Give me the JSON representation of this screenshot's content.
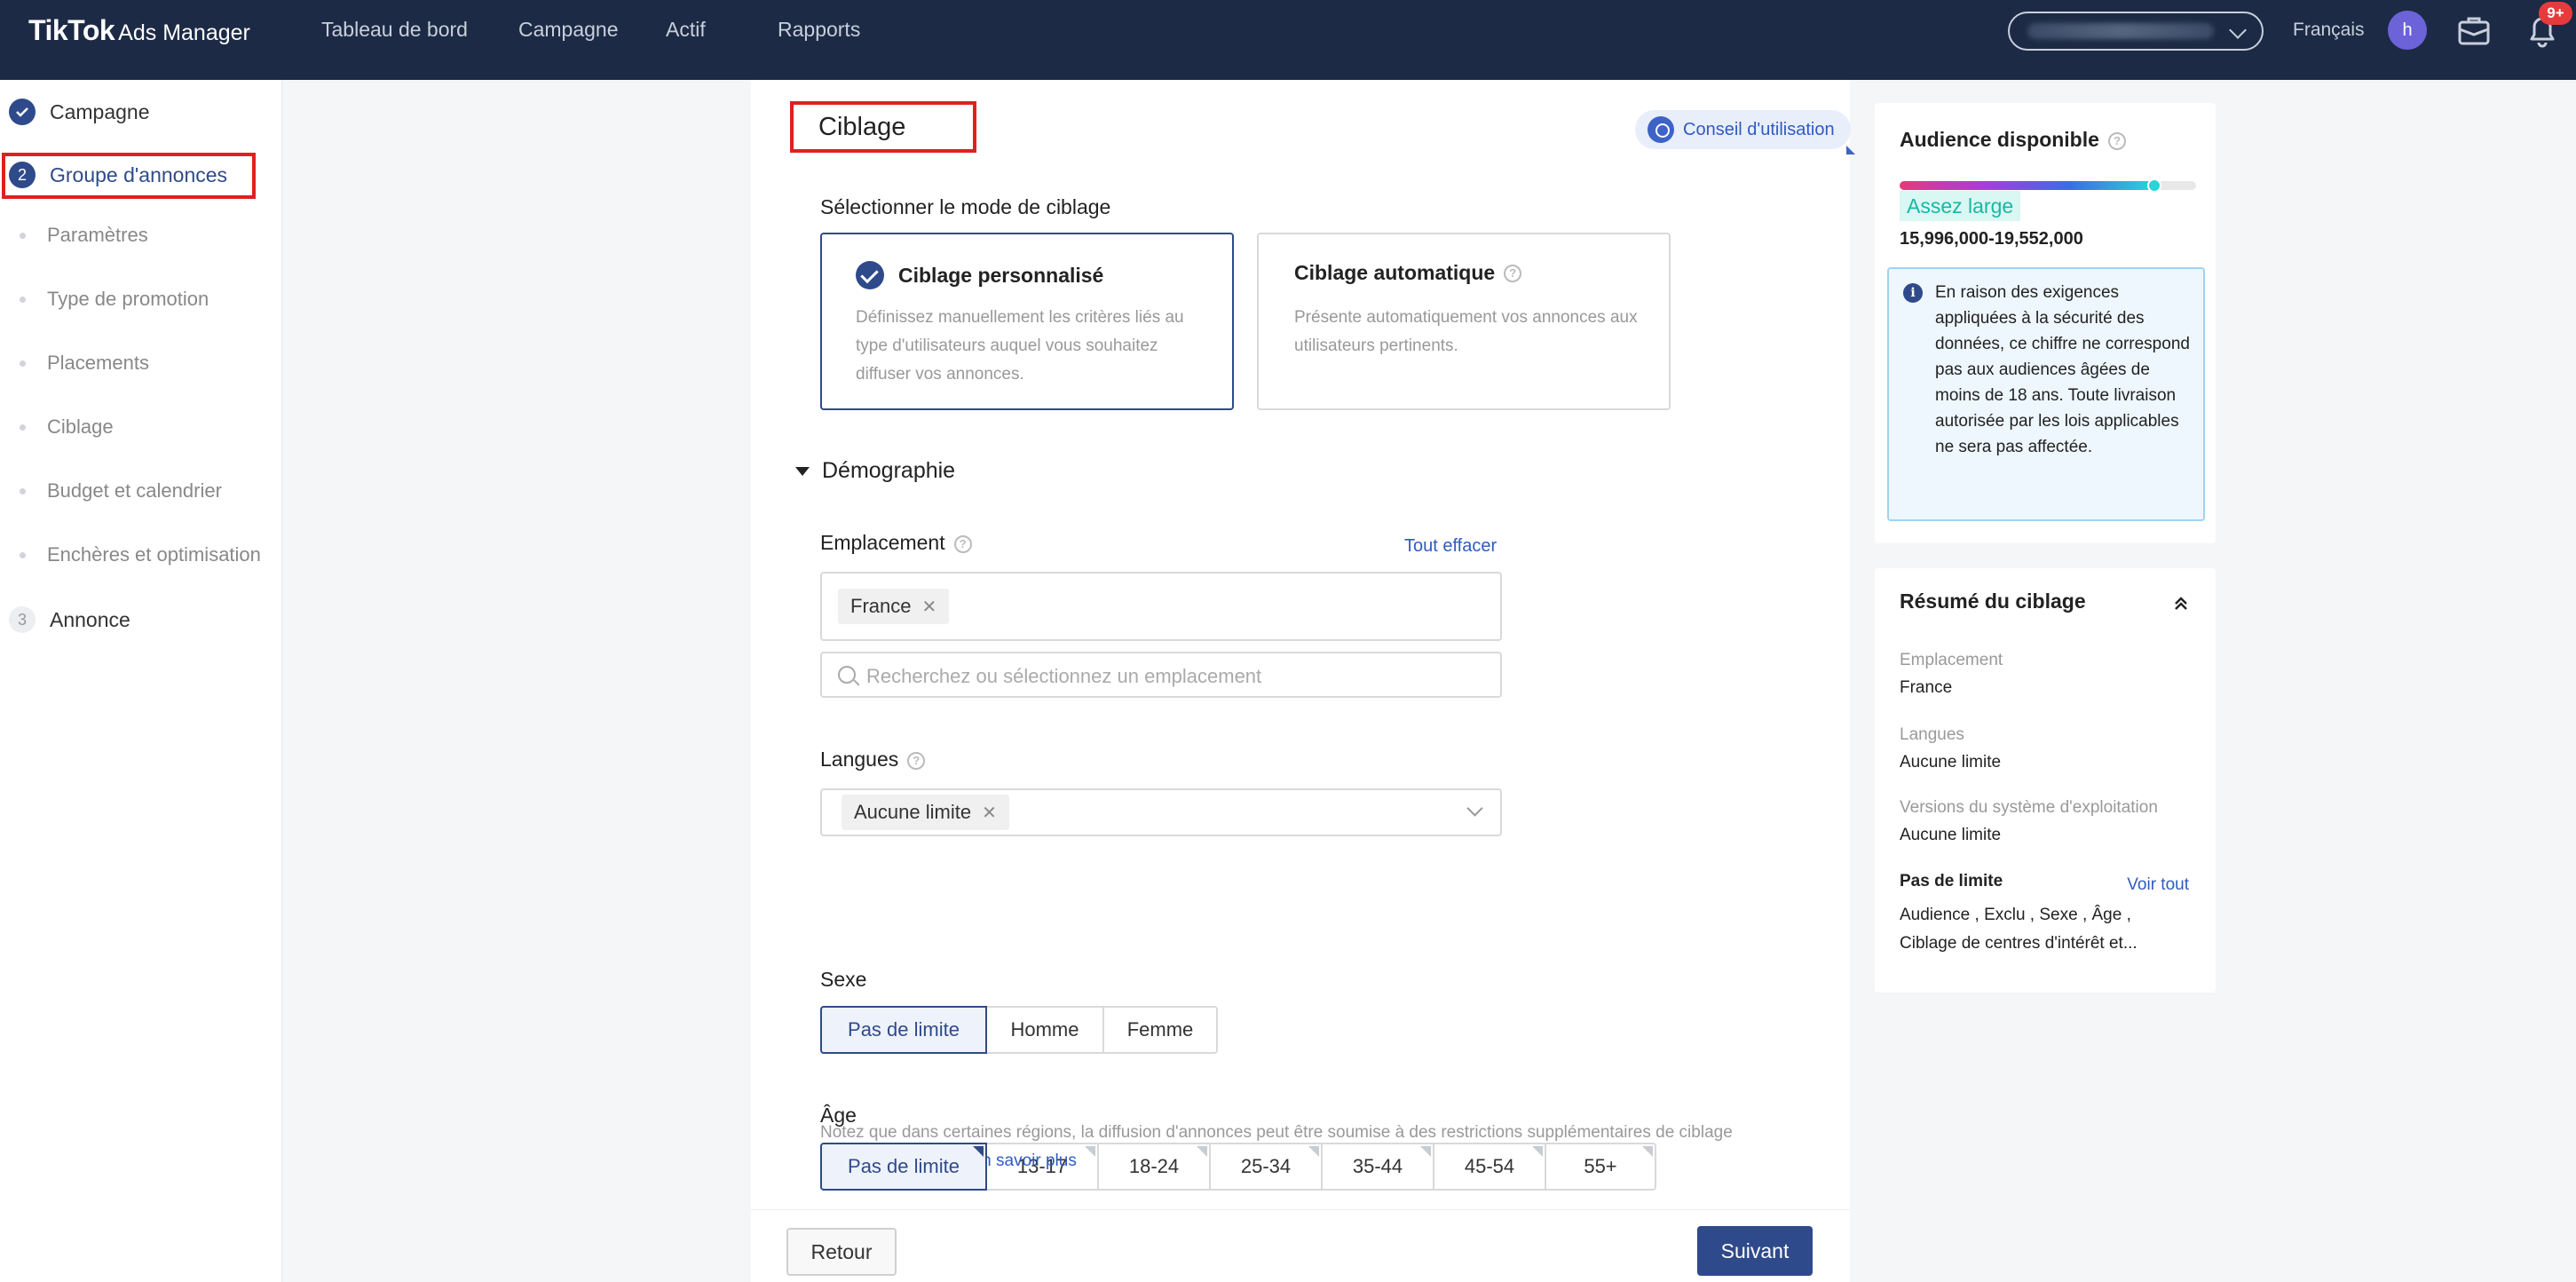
{
  "topnav": {
    "brand": "TikTok",
    "brand_sub": "Ads Manager",
    "links": [
      "Tableau de bord",
      "Campagne",
      "Actif",
      "Rapports"
    ],
    "language": "Français",
    "avatar_initial": "h",
    "notifications_badge": "9+",
    "icons": [
      "chevron-down-icon",
      "briefcase-icon",
      "bell-icon"
    ]
  },
  "sidebar": {
    "steps": [
      {
        "number": "",
        "label": "Campagne",
        "state": "done"
      },
      {
        "number": "2",
        "label": "Groupe d'annonces",
        "state": "active"
      },
      {
        "number": "3",
        "label": "Annonce",
        "state": "todo"
      }
    ],
    "substeps": [
      "Paramètres",
      "Type de promotion",
      "Placements",
      "Ciblage",
      "Budget et calendrier",
      "Enchères et optimisation"
    ]
  },
  "main": {
    "title": "Ciblage",
    "tip_button": "Conseil d'utilisation",
    "mode_label": "Sélectionner le mode de ciblage",
    "modes": [
      {
        "title": "Ciblage personnalisé",
        "description": "Définissez manuellement les critères liés au type d'utilisateurs auquel vous souhaitez diffuser vos annonces.",
        "selected": true
      },
      {
        "title": "Ciblage automatique",
        "description": "Présente automatiquement vos annonces aux utilisateurs pertinents.",
        "selected": false
      }
    ],
    "demography_title": "Démographie",
    "location": {
      "label": "Emplacement",
      "clear_all": "Tout effacer",
      "tags": [
        "France"
      ],
      "placeholder": "Recherchez ou sélectionnez un emplacement"
    },
    "languages": {
      "label": "Langues",
      "tags": [
        "Aucune limite"
      ]
    },
    "gender": {
      "label": "Sexe",
      "options": [
        "Pas de limite",
        "Homme",
        "Femme"
      ],
      "selected": "Pas de limite"
    },
    "age": {
      "label": "Âge",
      "options": [
        "Pas de limite",
        "13-17",
        "18-24",
        "25-34",
        "35-44",
        "45-54",
        "55+"
      ],
      "selected": "Pas de limite",
      "note": "Notez que dans certaines régions, la diffusion d'annonces peut être soumise à des restrictions supplémentaires de ciblage en fonction de l'âge.",
      "learn_more": "En savoir plus"
    },
    "footer": {
      "back": "Retour",
      "next": "Suivant"
    }
  },
  "audience": {
    "title": "Audience disponible",
    "meter_fraction": 0.86,
    "size_label": "Assez large",
    "range": "15,996,000-19,552,000",
    "info": "En raison des exigences appliquées à la sécurité des données, ce chiffre ne correspond pas aux audiences âgées de moins de 18 ans. Toute livraison autorisée par les lois applicables ne sera pas affectée."
  },
  "summary": {
    "title": "Résumé du ciblage",
    "items": [
      {
        "label": "Emplacement",
        "value": "France"
      },
      {
        "label": "Langues",
        "value": "Aucune limite"
      },
      {
        "label": "Versions du système d'exploitation",
        "value": "Aucune limite"
      }
    ],
    "unlimited_title": "Pas de limite",
    "see_all": "Voir tout",
    "unlimited_line1": "Audience , Exclu , Sexe , Âge ,",
    "unlimited_line2": "Ciblage de centres d'intérêt et..."
  },
  "colors": {
    "nav_bg": "#1c2a45",
    "primary": "#2f4a8a",
    "link": "#2f5bc0",
    "highlight_box": "#e02020",
    "badge": "#e63b3b",
    "size_badge_text": "#17b8a6"
  }
}
